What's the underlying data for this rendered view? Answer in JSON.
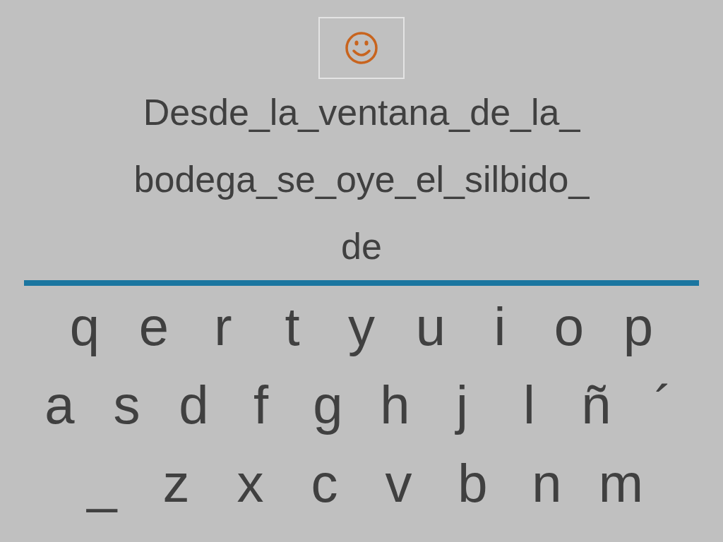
{
  "sentence_lines": [
    "Desde_la_ventana_de_la_",
    "bodega_se_oye_el_silbido_",
    "de"
  ],
  "keyboard_rows": [
    [
      "q",
      "e",
      "r",
      "t",
      "y",
      "u",
      "i",
      "o",
      "p"
    ],
    [
      "a",
      "s",
      "d",
      "f",
      "g",
      "h",
      "j",
      "l",
      "ñ",
      "´"
    ],
    [
      "_",
      "z",
      "x",
      "c",
      "v",
      "b",
      "n",
      "m"
    ]
  ]
}
